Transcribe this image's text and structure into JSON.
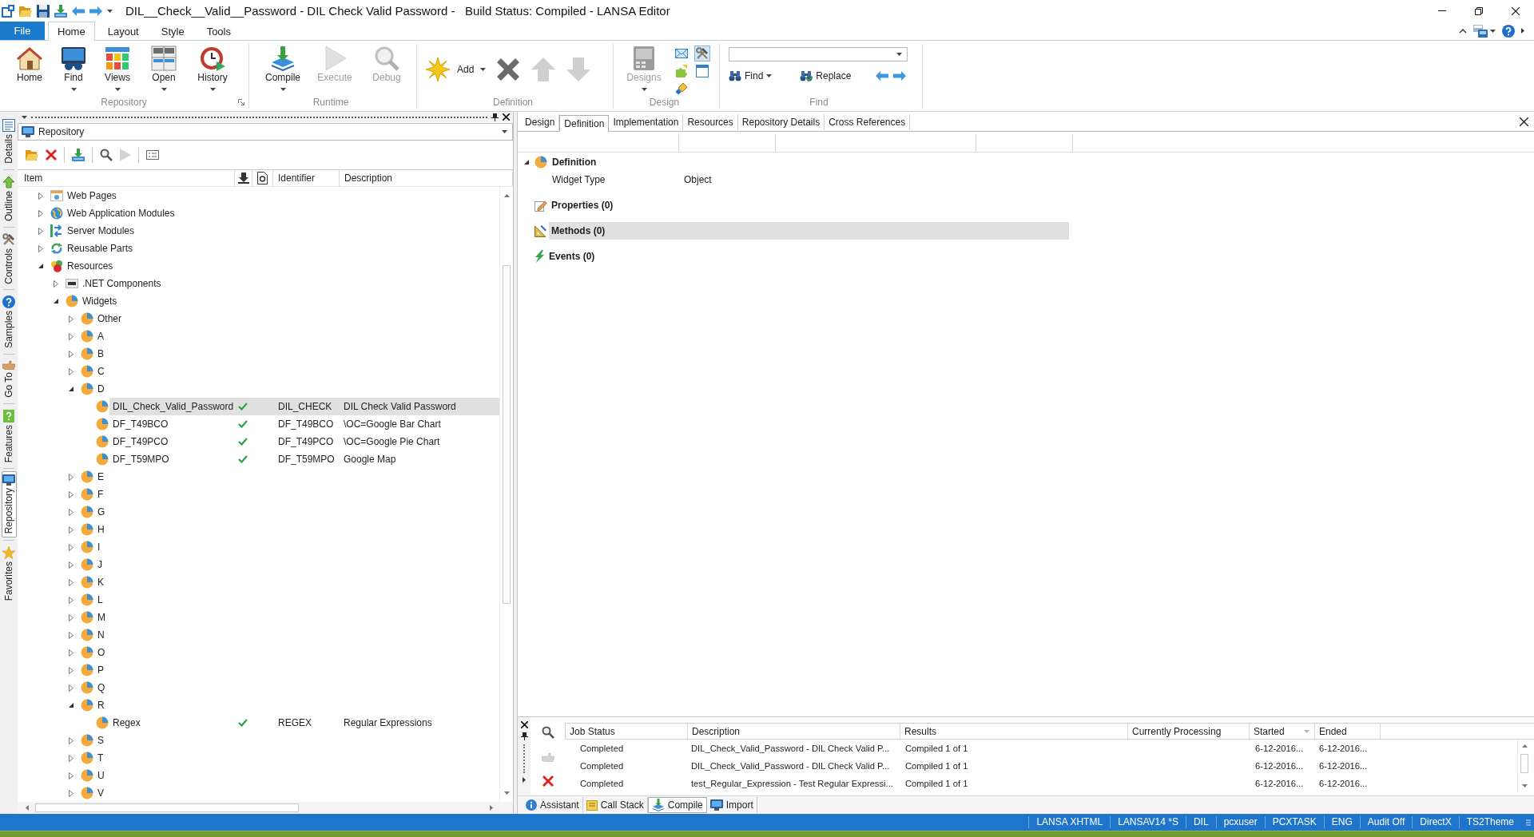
{
  "window": {
    "title": "DIL__Check__Valid__Password - DIL Check Valid Password -   Build Status: Compiled - LANSA Editor"
  },
  "ribbon": {
    "tabs": [
      {
        "label": "File",
        "kind": "file",
        "selected": false
      },
      {
        "label": "Home",
        "kind": "tab",
        "selected": true
      },
      {
        "label": "Layout",
        "kind": "tab",
        "selected": false
      },
      {
        "label": "Style",
        "kind": "tab",
        "selected": false
      },
      {
        "label": "Tools",
        "kind": "tab",
        "selected": false
      }
    ],
    "groups": [
      {
        "label": "Repository",
        "kind": "large",
        "launcher": true,
        "buttons": [
          {
            "label": "Home",
            "dropdown": false,
            "disabled": false
          },
          {
            "label": "Find",
            "dropdown": true,
            "disabled": false
          },
          {
            "label": "Views",
            "dropdown": true,
            "disabled": false
          },
          {
            "label": "Open",
            "dropdown": true,
            "disabled": false
          },
          {
            "label": "History",
            "dropdown": true,
            "disabled": false
          }
        ]
      },
      {
        "label": "Runtime",
        "kind": "large",
        "launcher": false,
        "buttons": [
          {
            "label": "Compile",
            "dropdown": true,
            "disabled": false
          },
          {
            "label": "Execute",
            "dropdown": false,
            "disabled": true
          },
          {
            "label": "Debug",
            "dropdown": false,
            "disabled": true
          }
        ]
      },
      {
        "label": "Definition",
        "kind": "row",
        "launcher": false,
        "buttons": [
          {
            "label": "Add",
            "dropdown": true,
            "disabled": false
          },
          {
            "dropdown": false,
            "disabled": false
          },
          {
            "dropdown": false,
            "disabled": true
          },
          {
            "dropdown": false,
            "disabled": true
          }
        ]
      },
      {
        "label": "Design",
        "kind": "design",
        "launcher": false,
        "buttons": [
          {
            "label": "Designs",
            "dropdown": true,
            "disabled": true
          }
        ],
        "small_buttons": [
          {
            "selected": false
          },
          {
            "selected": false
          },
          {
            "selected": false
          },
          {
            "selected": true
          },
          {
            "selected": false
          }
        ]
      },
      {
        "label": "Find",
        "kind": "find",
        "launcher": false,
        "buttons": [
          {
            "label": "Find",
            "dropdown": true,
            "disabled": false
          },
          {
            "label": "Replace",
            "dropdown": false,
            "disabled": false
          }
        ]
      }
    ]
  },
  "side_tabs": [
    {
      "label": "Details",
      "selected": false
    },
    {
      "label": "Outline",
      "selected": false
    },
    {
      "label": "Controls",
      "selected": false
    },
    {
      "label": "Samples",
      "selected": false
    },
    {
      "label": "Go To",
      "selected": false
    },
    {
      "label": "Features",
      "selected": false
    },
    {
      "label": "Repository",
      "selected": true
    },
    {
      "label": "Favorites",
      "selected": false
    }
  ],
  "repository": {
    "title": "Repository",
    "toolbar": [
      {
        "disabled": false
      },
      {
        "disabled": false
      },
      {
        "disabled": false
      },
      {
        "disabled": false
      },
      {
        "disabled": true
      },
      {
        "disabled": false
      }
    ],
    "columns": [
      {
        "kind": "text",
        "label": "Item"
      },
      {
        "kind": "icon"
      },
      {
        "kind": "icon"
      },
      {
        "kind": "text",
        "label": "Identifier"
      },
      {
        "kind": "text",
        "label": "Description"
      }
    ],
    "tree": [
      {
        "label": "Web Pages",
        "kind": "pages",
        "expanded": false,
        "selected": false
      },
      {
        "label": "Web Application Modules",
        "kind": "webapps",
        "expanded": false,
        "selected": false
      },
      {
        "label": "Server Modules",
        "kind": "server",
        "expanded": false,
        "selected": false
      },
      {
        "label": "Reusable Parts",
        "kind": "parts",
        "expanded": false,
        "selected": false
      },
      {
        "label": "Resources",
        "kind": "resources",
        "expanded": true,
        "selected": false,
        "children": [
          {
            "label": ".NET Components",
            "kind": "dotnet",
            "expanded": false,
            "selected": false
          },
          {
            "label": "Widgets",
            "kind": "widget",
            "expanded": true,
            "selected": false,
            "children": [
              {
                "label": "Other",
                "expanded": false,
                "selected": false
              },
              {
                "label": "A",
                "expanded": false,
                "selected": false
              },
              {
                "label": "B",
                "expanded": false,
                "selected": false
              },
              {
                "label": "C",
                "expanded": false,
                "selected": false
              },
              {
                "label": "D",
                "expanded": true,
                "selected": false,
                "children": [
                  {
                    "label": "DIL_Check_Valid_Password",
                    "compiled": true,
                    "identifier": "DIL_CHECK",
                    "description": "DIL Check Valid Password",
                    "selected": true
                  },
                  {
                    "label": "DF_T49BCO",
                    "compiled": true,
                    "identifier": "DF_T49BCO",
                    "description": "\\OC=Google Bar Chart",
                    "selected": false
                  },
                  {
                    "label": "DF_T49PCO",
                    "compiled": true,
                    "identifier": "DF_T49PCO",
                    "description": "\\OC=Google Pie Chart",
                    "selected": false
                  },
                  {
                    "label": "DF_T59MPO",
                    "compiled": true,
                    "identifier": "DF_T59MPO",
                    "description": "Google Map",
                    "selected": false
                  }
                ]
              },
              {
                "label": "E",
                "expanded": false,
                "selected": false
              },
              {
                "label": "F",
                "expanded": false,
                "selected": false
              },
              {
                "label": "G",
                "expanded": false,
                "selected": false
              },
              {
                "label": "H",
                "expanded": false,
                "selected": false
              },
              {
                "label": "I",
                "expanded": false,
                "selected": false
              },
              {
                "label": "J",
                "expanded": false,
                "selected": false
              },
              {
                "label": "K",
                "expanded": false,
                "selected": false
              },
              {
                "label": "L",
                "expanded": false,
                "selected": false
              },
              {
                "label": "M",
                "expanded": false,
                "selected": false
              },
              {
                "label": "N",
                "expanded": false,
                "selected": false
              },
              {
                "label": "O",
                "expanded": false,
                "selected": false
              },
              {
                "label": "P",
                "expanded": false,
                "selected": false
              },
              {
                "label": "Q",
                "expanded": false,
                "selected": false
              },
              {
                "label": "R",
                "expanded": true,
                "selected": false,
                "children": [
                  {
                    "label": "Regex",
                    "compiled": true,
                    "identifier": "REGEX",
                    "description": "Regular Expressions",
                    "selected": false
                  }
                ]
              },
              {
                "label": "S",
                "expanded": false,
                "selected": false
              },
              {
                "label": "T",
                "expanded": false,
                "selected": false
              },
              {
                "label": "U",
                "expanded": false,
                "selected": false
              },
              {
                "label": "V",
                "expanded": false,
                "selected": false
              }
            ]
          }
        ]
      }
    ]
  },
  "editor": {
    "tabs": [
      {
        "label": "Design",
        "selected": false
      },
      {
        "label": "Definition",
        "selected": true
      },
      {
        "label": "Implementation",
        "selected": false
      },
      {
        "label": "Resources",
        "selected": false
      },
      {
        "label": "Repository Details",
        "selected": false
      },
      {
        "label": "Cross References",
        "selected": false
      }
    ],
    "definition": {
      "label": "Definition",
      "expanded": true,
      "rows": [
        {
          "name": "Widget Type",
          "value": "Object"
        }
      ]
    },
    "members": [
      {
        "label": "Properties (0)",
        "kind": "properties",
        "selected": false
      },
      {
        "label": "Methods (0)",
        "kind": "methods",
        "selected": true
      },
      {
        "label": "Events (0)",
        "kind": "events",
        "selected": false
      }
    ]
  },
  "output": {
    "toolbar": [
      {
        "disabled": false
      },
      {
        "disabled": true
      },
      {
        "disabled": false
      }
    ],
    "columns": [
      {
        "label": "Job Status",
        "sorted": false
      },
      {
        "label": "Description",
        "sorted": false
      },
      {
        "label": "Results",
        "sorted": false
      },
      {
        "label": "Currently Processing",
        "sorted": false
      },
      {
        "label": "Started",
        "sorted": true
      },
      {
        "label": "Ended",
        "sorted": false
      }
    ],
    "rows": [
      {
        "job_status": "Completed",
        "description": "DIL_Check_Valid_Password - DIL Check Valid P...",
        "results": "Compiled 1 of 1",
        "started": "6-12-2016...",
        "ended": "6-12-2016..."
      },
      {
        "job_status": "Completed",
        "description": "DIL_Check_Valid_Password - DIL Check Valid P...",
        "results": "Compiled 1 of 1",
        "started": "6-12-2016...",
        "ended": "6-12-2016..."
      },
      {
        "job_status": "Completed",
        "description": "test_Regular_Expression - Test Regular Expressi...",
        "results": "Compiled 1 of 1",
        "started": "6-12-2016...",
        "ended": "6-12-2016..."
      }
    ],
    "tabs": [
      {
        "label": "Assistant",
        "selected": false
      },
      {
        "label": "Call Stack",
        "selected": false
      },
      {
        "label": "Compile",
        "selected": true
      },
      {
        "label": "Import",
        "selected": false
      }
    ]
  },
  "status_bar": {
    "items": [
      "LANSA XHTML",
      "LANSAV14 *S",
      "DIL",
      "pcxuser",
      "PCXTASK",
      "ENG",
      "Audit Off",
      "DirectX",
      "TS2Theme"
    ]
  }
}
